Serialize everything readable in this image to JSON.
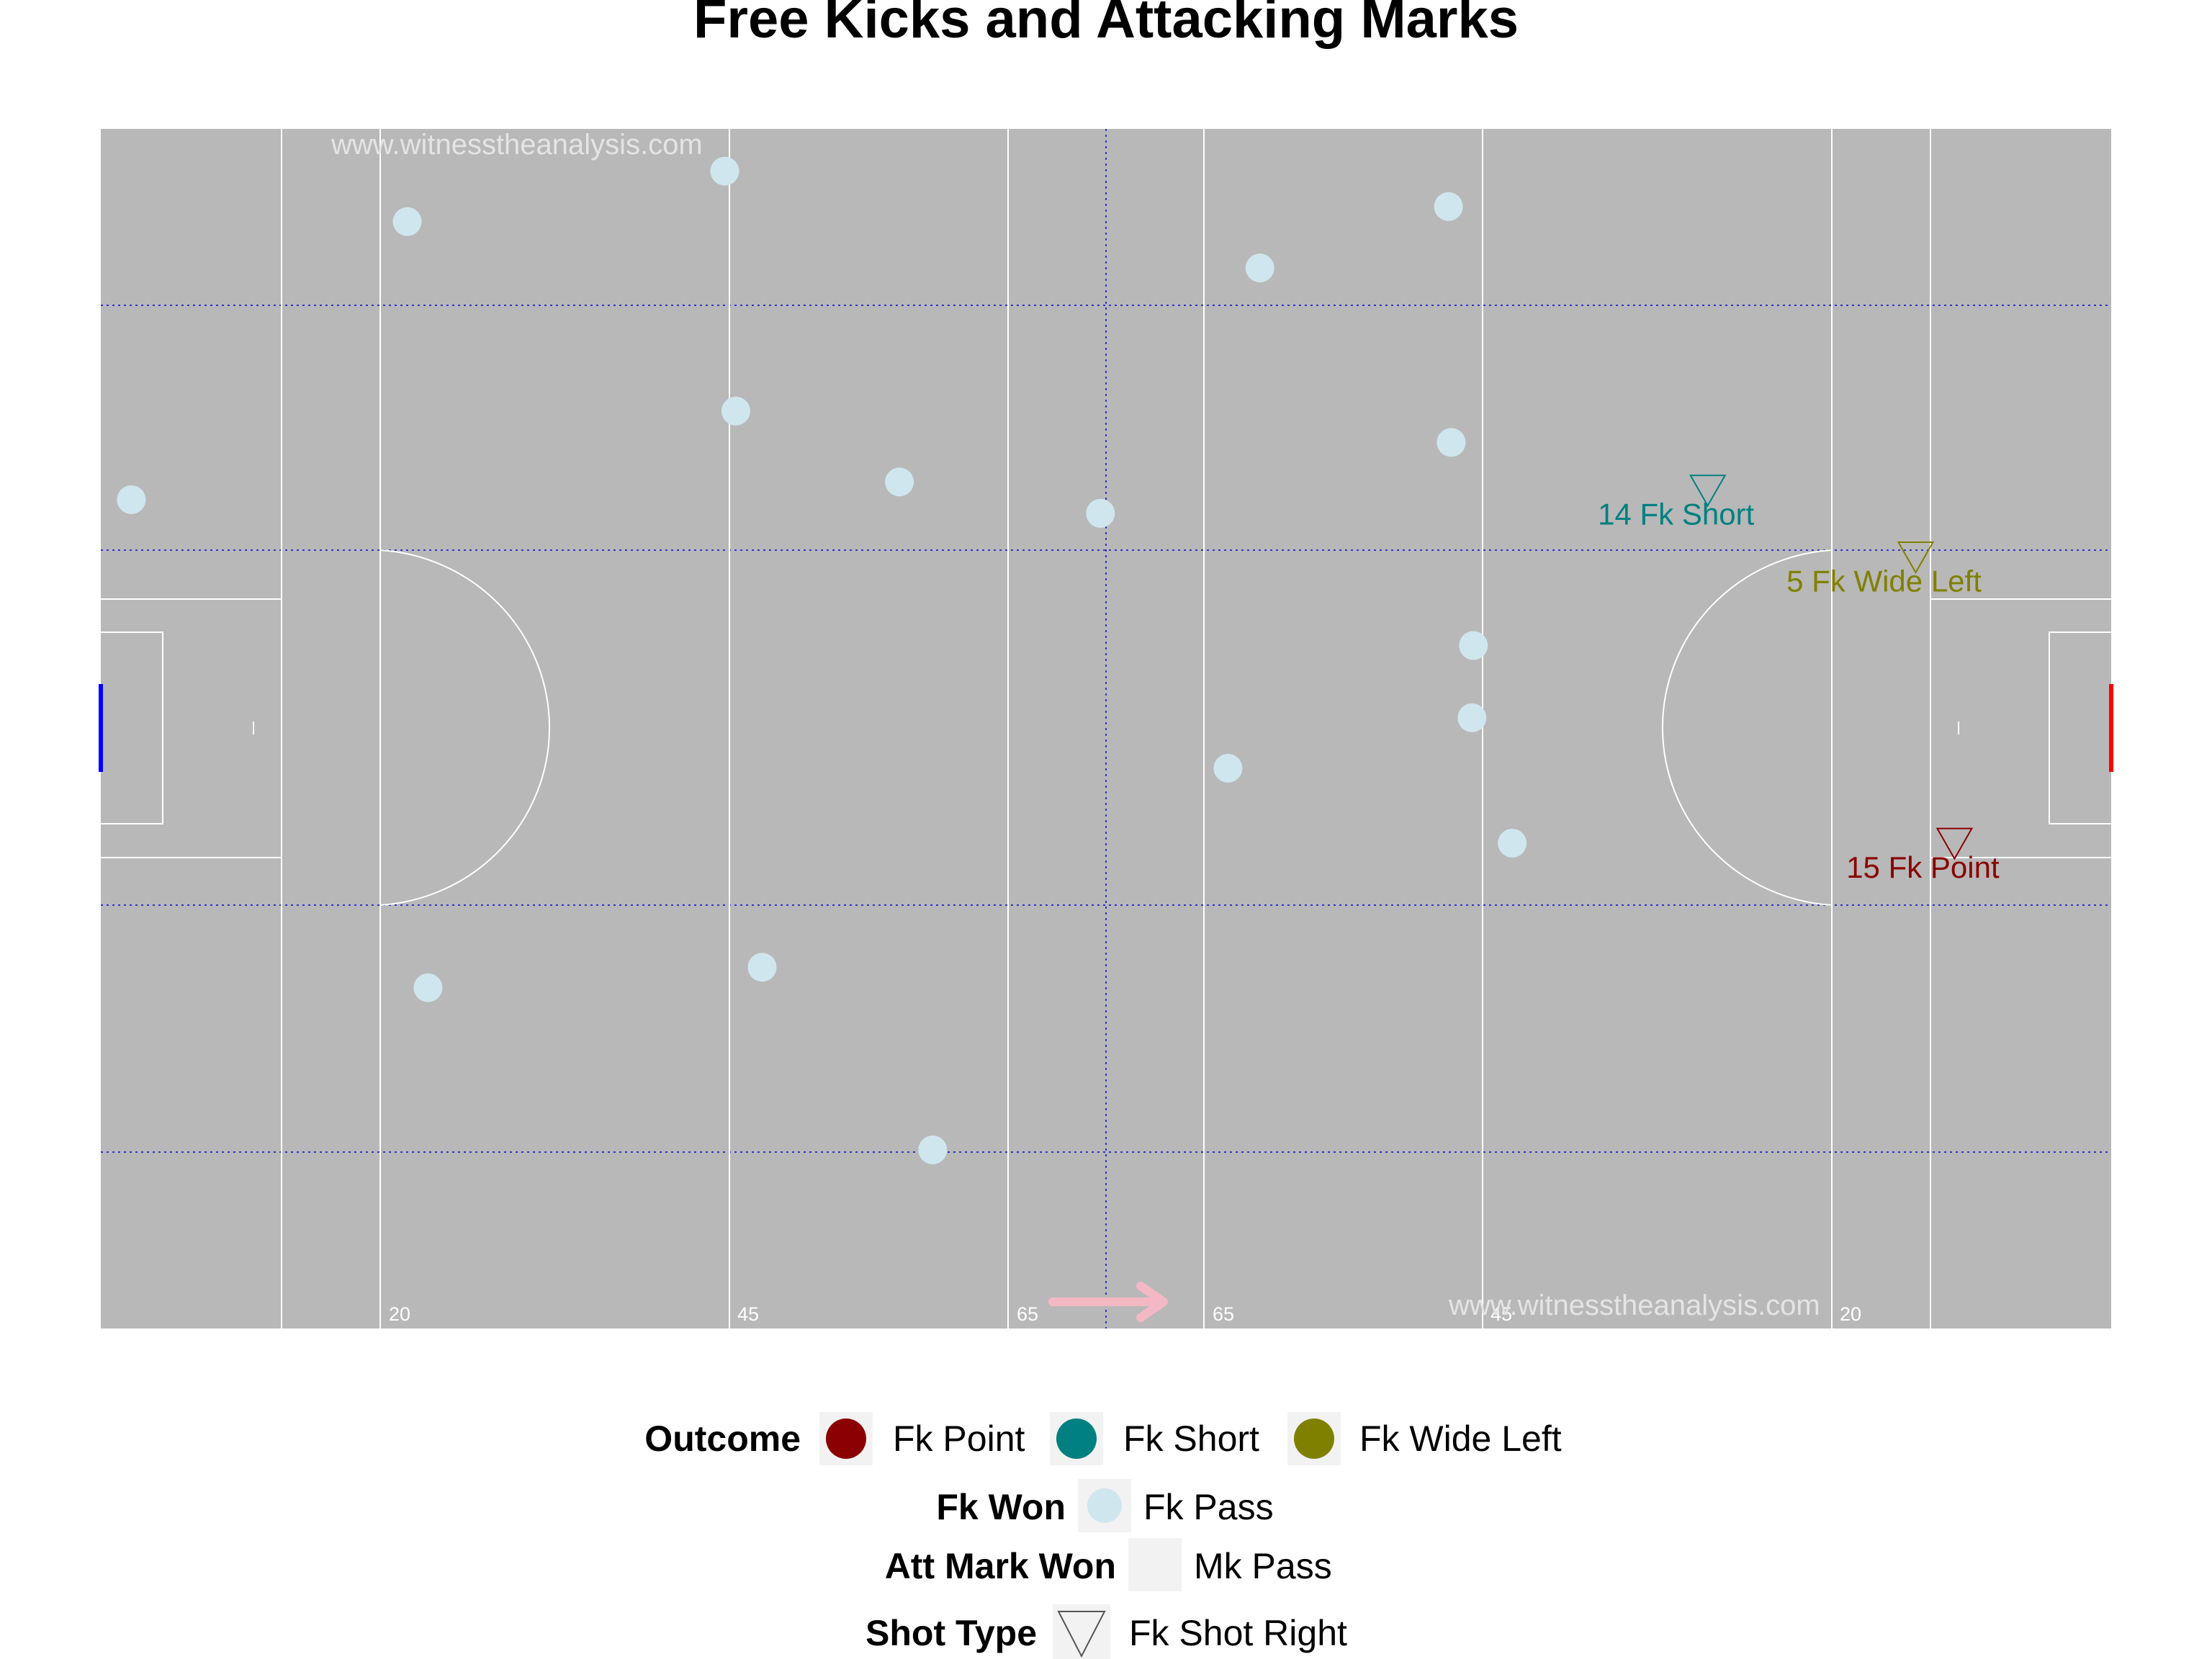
{
  "title": "Free Kicks and Attacking Marks",
  "watermarks": [
    "www.witnesstheanalysis.com",
    "www.witnesstheanalysis.com"
  ],
  "colors": {
    "pitch": "#b8b8b8",
    "pitch_lines": "#ffffff",
    "zone_lines": "#3333cc",
    "fk_point": "#8b0000",
    "fk_short": "#008080",
    "fk_wide_left": "#808000",
    "fk_pass": "#cfe6ee",
    "mk_pass": "#f2f2f2",
    "left_goal": "#0000ff",
    "right_goal": "#ff0000",
    "direction_arrow": "#f4b8c4"
  },
  "pitch_labels": [
    "20",
    "45",
    "65",
    "65",
    "45",
    "20"
  ],
  "legend": {
    "outcome": {
      "title": "Outcome",
      "items": [
        "Fk Point",
        "Fk Short",
        "Fk Wide Left"
      ]
    },
    "fk_won": {
      "title": "Fk Won",
      "items": [
        "Fk Pass"
      ]
    },
    "att_mark_won": {
      "title": "Att Mark Won",
      "items": [
        "Mk Pass"
      ]
    },
    "shot_type": {
      "title": "Shot Type",
      "items": [
        "Fk Shot Right"
      ]
    }
  },
  "chart_data": {
    "type": "scatter",
    "title": "Free Kicks and Attacking Marks",
    "xlim": [
      0,
      145
    ],
    "ylim": [
      0,
      88
    ],
    "direction": "left-to-right",
    "grid": false,
    "legend_position": "bottom",
    "series": [
      {
        "name": "Fk Pass",
        "points": [
          {
            "x": 2.2,
            "y": 60.8
          },
          {
            "x": 22.1,
            "y": 81.2
          },
          {
            "x": 45.0,
            "y": 84.9
          },
          {
            "x": 45.8,
            "y": 67.3
          },
          {
            "x": 57.6,
            "y": 62.1
          },
          {
            "x": 72.1,
            "y": 59.8
          },
          {
            "x": 83.6,
            "y": 77.8
          },
          {
            "x": 97.2,
            "y": 82.3
          },
          {
            "x": 97.4,
            "y": 65.0
          },
          {
            "x": 99.0,
            "y": 50.1
          },
          {
            "x": 98.9,
            "y": 44.8
          },
          {
            "x": 81.3,
            "y": 41.1
          },
          {
            "x": 101.8,
            "y": 35.6
          },
          {
            "x": 23.6,
            "y": 25.0
          },
          {
            "x": 47.7,
            "y": 26.5
          },
          {
            "x": 60.0,
            "y": 13.1
          }
        ]
      },
      {
        "name": "Fk Shot Right",
        "points": [
          {
            "x": 115.9,
            "y": 61.5,
            "outcome": "Fk Short",
            "label": "14 Fk Short"
          },
          {
            "x": 130.9,
            "y": 56.6,
            "outcome": "Fk Wide Left",
            "label": "5 Fk Wide Left"
          },
          {
            "x": 133.7,
            "y": 35.6,
            "outcome": "Fk Point",
            "label": "15 Fk Point"
          }
        ]
      }
    ]
  }
}
